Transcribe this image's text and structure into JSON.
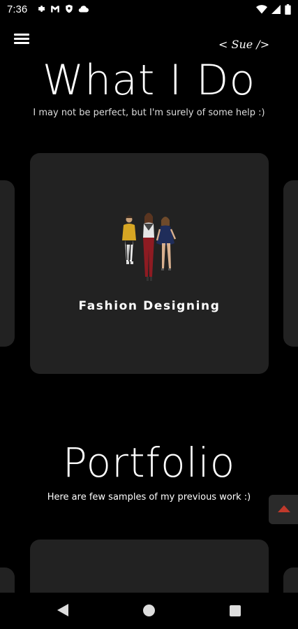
{
  "status_bar": {
    "time": "7:36",
    "left_icons": [
      "gear-icon",
      "gmail-icon",
      "shield-icon",
      "cloud-icon"
    ],
    "right_icons": [
      "wifi-icon",
      "signal-icon",
      "battery-icon"
    ]
  },
  "header": {
    "logo_text": "< Sue />"
  },
  "what_i_do": {
    "title": "What I Do",
    "subtitle": "I may not be perfect, but I'm surely of some help :)",
    "cards": [
      {
        "label": "Fashion Designing",
        "icon": "fashion-models-illustration"
      }
    ]
  },
  "portfolio": {
    "title": "Portfolio",
    "subtitle": "Here are few samples of my previous work :)"
  },
  "scroll_top": {
    "icon": "arrow-up-icon",
    "color": "#c0392b"
  },
  "nav_bar": {
    "icons": [
      "back-icon",
      "home-icon",
      "recents-icon"
    ]
  },
  "colors": {
    "background": "#000000",
    "card": "#222222",
    "accent": "#c0392b"
  }
}
